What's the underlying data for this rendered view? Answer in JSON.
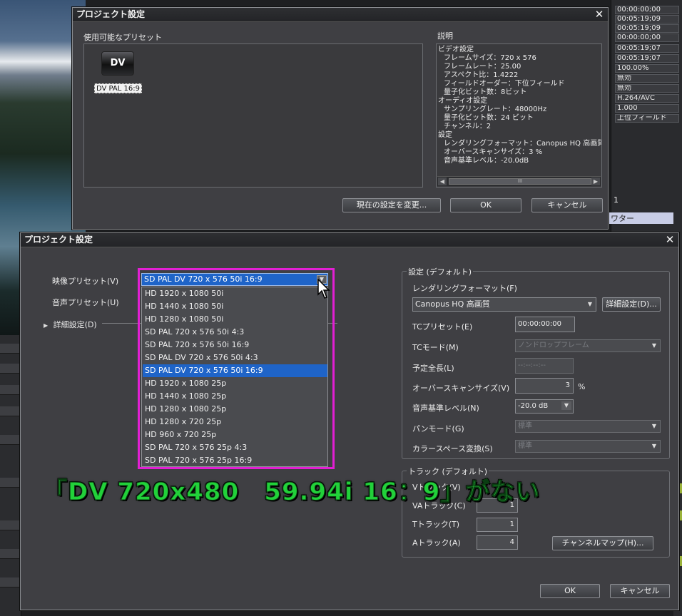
{
  "background": {
    "right_panel_values": [
      "00:00:00;00",
      "00:05:19;09",
      "00:05:19;09",
      "00:00:00;00",
      "00:05:19;07",
      "00:05:19;07",
      "100.00%",
      "無効",
      "無効",
      "H.264/AVC",
      "1.000",
      "上位フィールド"
    ],
    "right_panel_extra": [
      "1",
      "ワター"
    ]
  },
  "top_dialog": {
    "title": "プロジェクト設定",
    "available_presets_label": "使用可能なプリセット",
    "preset_icon_text": "DV",
    "preset_name": "DV PAL 16:9",
    "description_label": "説明",
    "description_lines": [
      "ビデオ設定",
      "フレームサイズ：720 x 576",
      "フレームレート：25.00",
      "アスペクト比：1.4222",
      "フィールドオーダー：下位フィールド",
      "量子化ビット数：8ビット",
      "オーディオ設定",
      "サンプリングレート：48000Hz",
      "量子化ビット数：24 ビット",
      "チャンネル：2",
      "設定",
      "レンダリングフォーマット：Canopus HQ 高画質",
      "オーバースキャンサイズ：3 %",
      "音声基準レベル：-20.0dB"
    ],
    "scroll_thumb_grip": "III",
    "change_settings_button": "現在の設定を変更...",
    "ok_button": "OK",
    "cancel_button": "キャンセル"
  },
  "main_dialog": {
    "title": "プロジェクト設定",
    "video_preset_label": "映像プリセット(V)",
    "audio_preset_label": "音声プリセット(U)",
    "detail_settings_label": "詳細設定(D)",
    "video_preset_selected": "SD PAL DV 720 x 576 50i 16:9",
    "video_preset_options": [
      "HD 1920 x 1080 50i",
      "HD 1440 x 1080 50i",
      "HD 1280 x 1080 50i",
      "SD PAL 720 x 576 50i 4:3",
      "SD PAL 720 x 576 50i 16:9",
      "SD PAL DV 720 x 576 50i 4:3",
      "SD PAL DV 720 x 576 50i 16:9",
      "HD 1920 x 1080 25p",
      "HD 1440 x 1080 25p",
      "HD 1280 x 1080 25p",
      "HD 1280 x 720 25p",
      "HD 960 x 720 25p",
      "SD PAL 720 x 576 25p 4:3",
      "SD PAL 720 x 576 25p 16:9"
    ],
    "settings_group": {
      "title": "設定 (デフォルト)",
      "rendering_format_label": "レンダリングフォーマット(F)",
      "rendering_format_value": "Canopus HQ 高画質",
      "detail_button": "詳細設定(D)...",
      "tc_preset_label": "TCプリセット(E)",
      "tc_preset_value": "00:00:00:00",
      "tc_mode_label": "TCモード(M)",
      "tc_mode_value": "ノンドロップフレーム",
      "planned_length_label": "予定全長(L)",
      "planned_length_value": "--:--:--:--",
      "overscan_label": "オーバースキャンサイズ(V)",
      "overscan_value": "3",
      "overscan_unit": "%",
      "audio_ref_label": "音声基準レベル(N)",
      "audio_ref_value": "-20.0 dB",
      "pan_mode_label": "パンモード(G)",
      "pan_mode_value": "標準",
      "colorspace_label": "カラースペース変換(S)",
      "colorspace_value": "標準"
    },
    "track_group": {
      "title": "トラック (デフォルト)",
      "v_track_label": "Vトラック(V)",
      "va_track_label": "VAトラック(C)",
      "va_track_value": "1",
      "t_track_label": "Tトラック(T)",
      "t_track_value": "1",
      "a_track_label": "Aトラック(A)",
      "a_track_value": "4",
      "channel_map_button": "チャンネルマップ(H)..."
    },
    "ok_button": "OK",
    "cancel_button": "キャンセル"
  },
  "caption": "「DV 720x480　59.94i 16：9」がない",
  "colors": {
    "highlight_frame": "#e21fd3",
    "caption_green": "#22d13a",
    "selection_blue": "#1f64c8"
  }
}
